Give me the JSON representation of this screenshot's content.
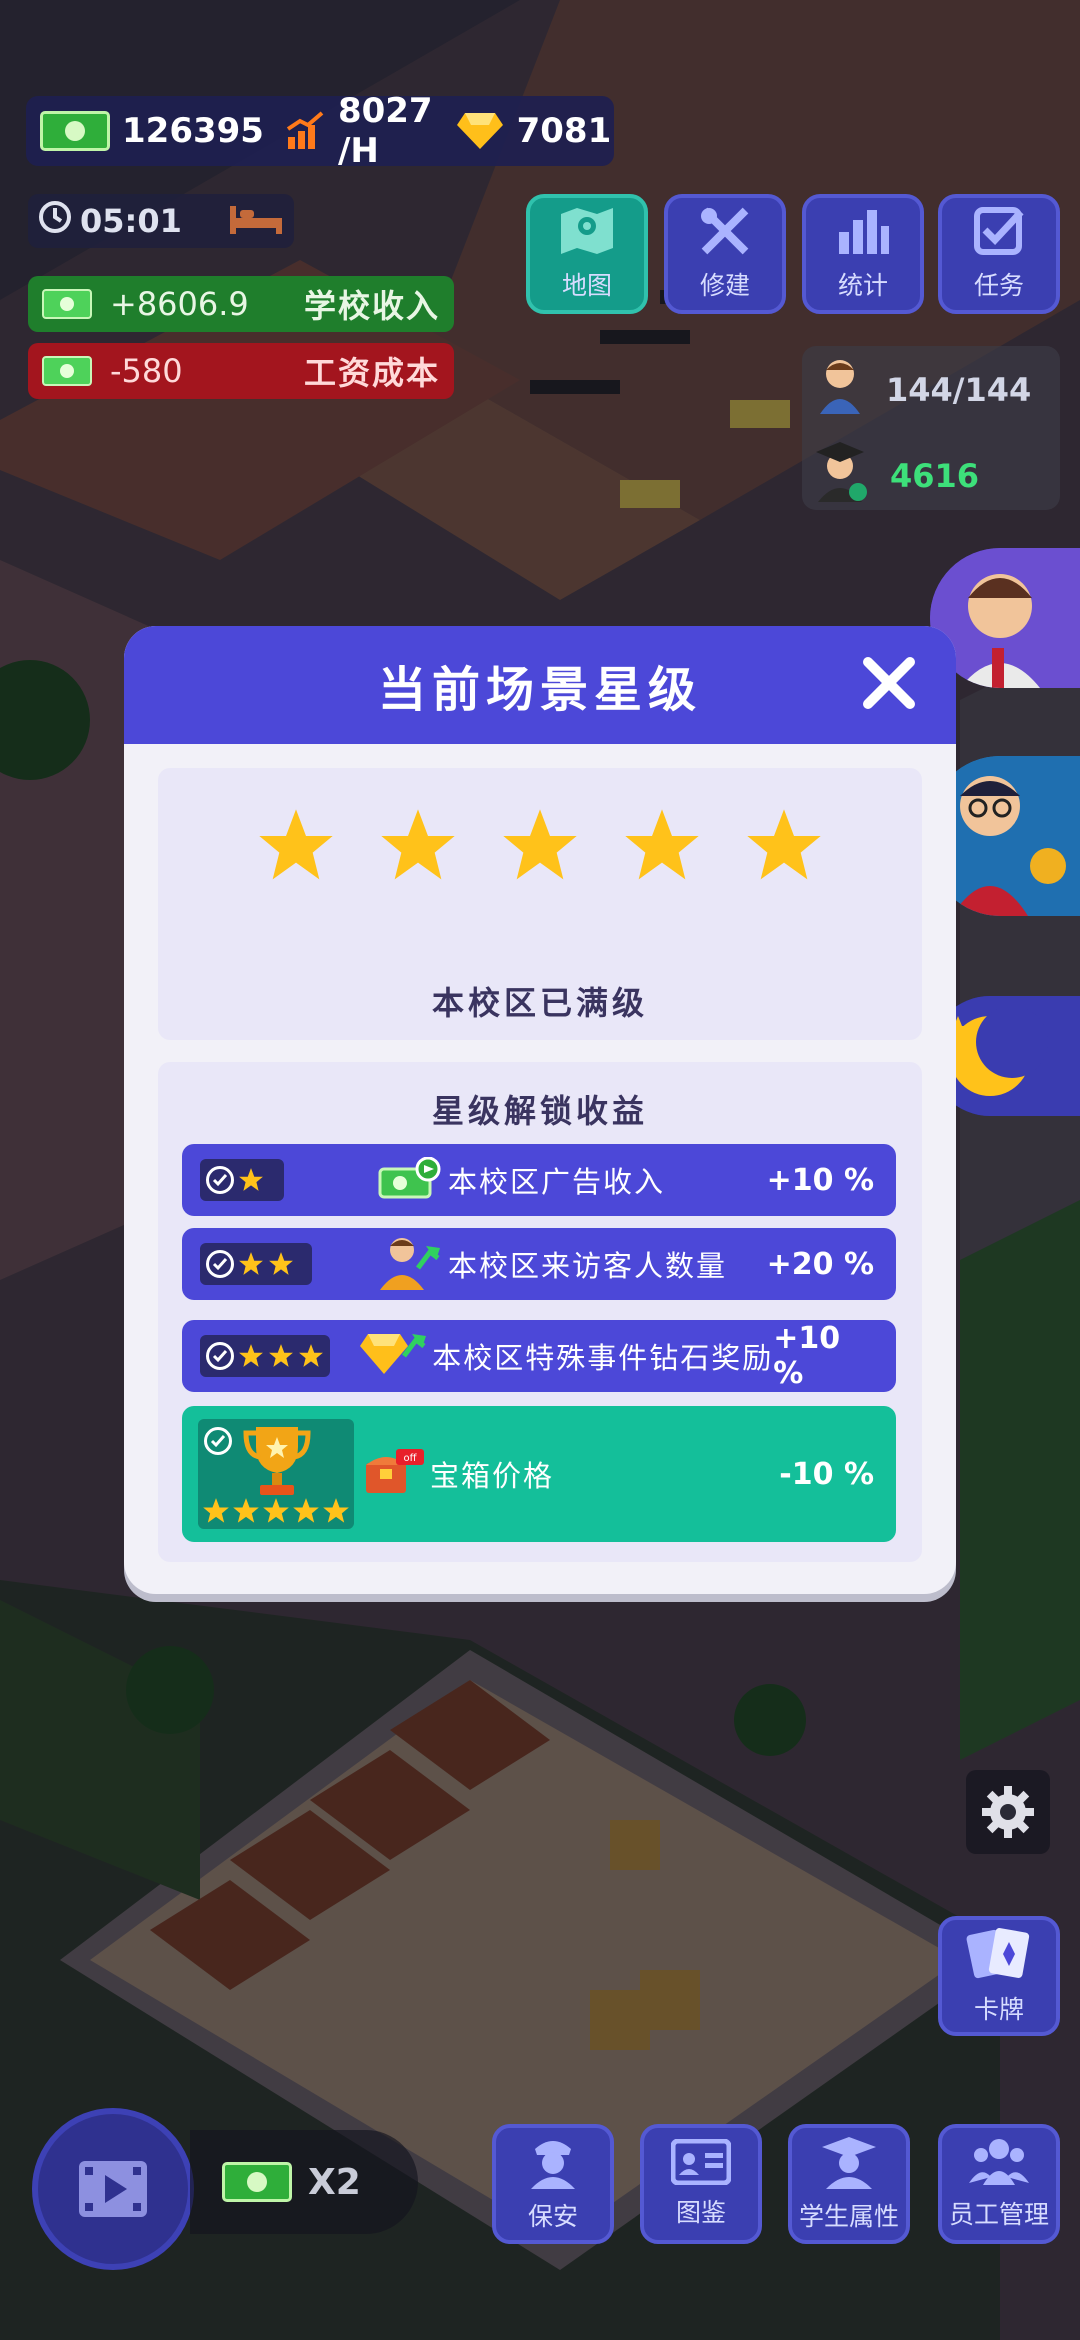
{
  "hud": {
    "cash": "126395",
    "income_rate": "8027 /H",
    "gems": "7081",
    "timer": "05:01",
    "school_income": {
      "value": "+8606.9",
      "label": "学校收入"
    },
    "salary_cost": {
      "value": "-580",
      "label": "工资成本"
    },
    "population": "144/144",
    "graduates": "4616"
  },
  "top_menu": [
    {
      "label": "地图",
      "icon": "map-icon"
    },
    {
      "label": "修建",
      "icon": "build-tools-icon"
    },
    {
      "label": "统计",
      "icon": "bar-chart-icon"
    },
    {
      "label": "任务",
      "icon": "task-check-icon"
    }
  ],
  "side": {
    "cards_label": "卡牌"
  },
  "bottom": {
    "x2_label": "X2",
    "menu": [
      {
        "label": "保安",
        "icon": "security-guard-icon"
      },
      {
        "label": "图鉴",
        "icon": "id-card-icon"
      },
      {
        "label": "学生属性",
        "icon": "graduate-icon"
      },
      {
        "label": "员工管理",
        "icon": "staff-group-icon"
      }
    ]
  },
  "modal": {
    "title": "当前场景星级",
    "star_rating": 5,
    "max_level_text": "本校区已满级",
    "bonus_title": "星级解锁收益",
    "bonuses": [
      {
        "stars": 1,
        "icon": "cash-ad-icon",
        "label": "本校区广告收入",
        "value": "+10 %"
      },
      {
        "stars": 2,
        "icon": "visitor-icon",
        "label": "本校区来访客人数量",
        "value": "+20 %"
      },
      {
        "stars": 3,
        "icon": "diamond-icon",
        "label": "本校区特殊事件钻石奖励",
        "value": "+10 %"
      },
      {
        "stars": 5,
        "icon": "chest-discount-icon",
        "label": "宝箱价格",
        "value": "-10 %"
      }
    ]
  },
  "colors": {
    "modal_header": "#4c48d8",
    "bonus_row": "#4c48d8",
    "final_bonus_row": "#14bf9a",
    "star": "#ffc21a"
  }
}
